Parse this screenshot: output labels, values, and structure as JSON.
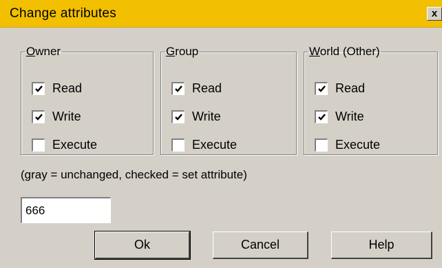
{
  "window": {
    "title": "Change attributes",
    "close_glyph": "x"
  },
  "groups": [
    {
      "legend_key": "O",
      "legend_rest": "wner",
      "items": [
        {
          "label": "Read",
          "checked": true
        },
        {
          "label": "Write",
          "checked": true
        },
        {
          "label": "Execute",
          "checked": false
        }
      ]
    },
    {
      "legend_key": "G",
      "legend_rest": "roup",
      "items": [
        {
          "label": "Read",
          "checked": true
        },
        {
          "label": "Write",
          "checked": true
        },
        {
          "label": "Execute",
          "checked": false
        }
      ]
    },
    {
      "legend_key": "W",
      "legend_rest": "orld (Other)",
      "items": [
        {
          "label": "Read",
          "checked": true
        },
        {
          "label": "Write",
          "checked": true
        },
        {
          "label": "Execute",
          "checked": false
        }
      ]
    }
  ],
  "hint": "(gray = unchanged, checked = set attribute)",
  "octal": {
    "value": "666"
  },
  "buttons": {
    "ok": "Ok",
    "cancel": "Cancel",
    "help": "Help"
  },
  "colors": {
    "titlebar": "#f2c000",
    "face": "#d4d0c8"
  }
}
